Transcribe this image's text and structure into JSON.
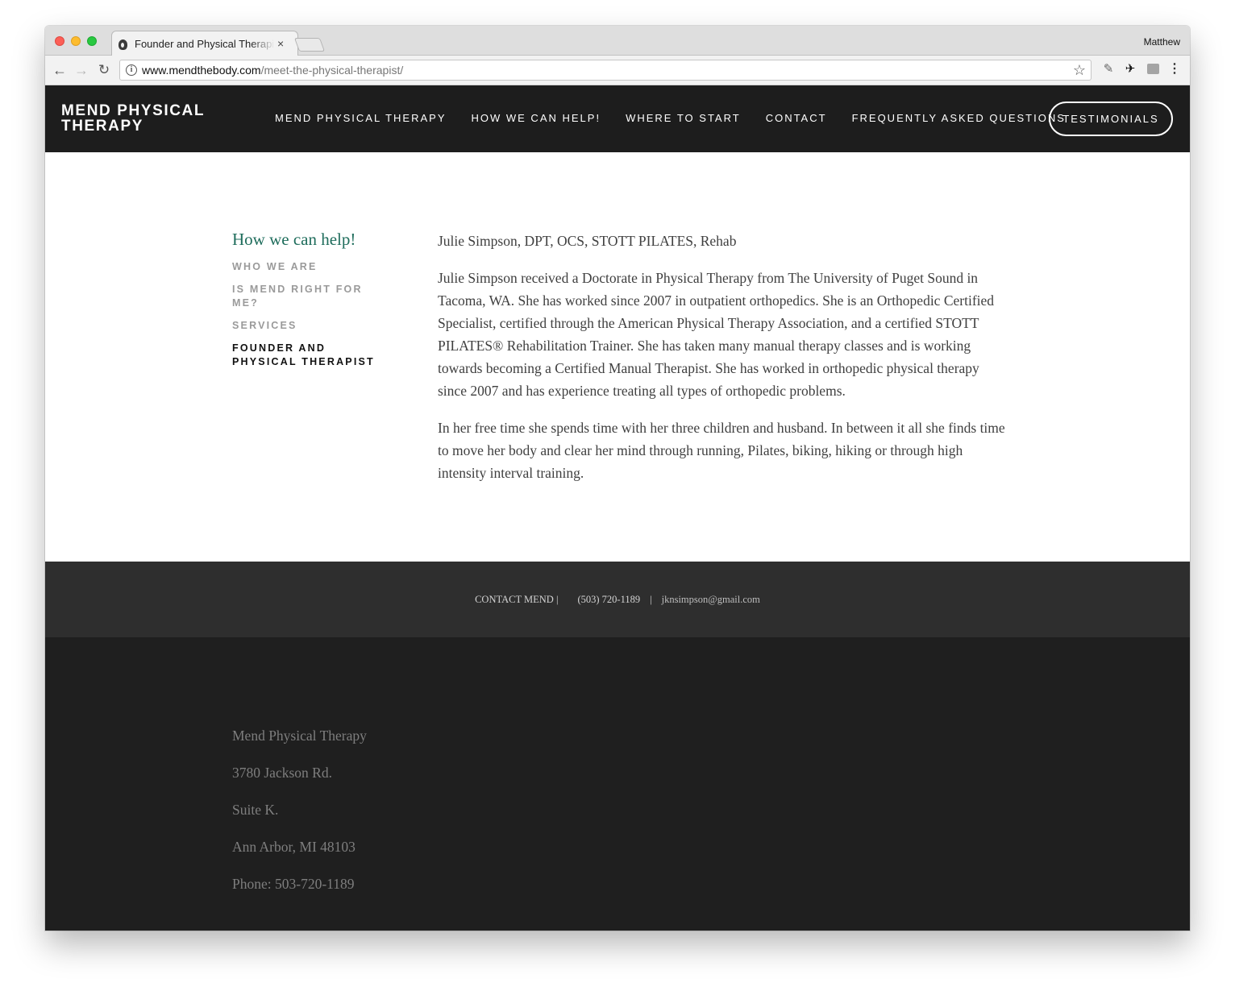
{
  "browser": {
    "tab_title": "Founder and Physical Therapist",
    "tab_close": "×",
    "profile_name": "Matthew",
    "url_host": "www.mendthebody.com",
    "url_path": "/meet-the-physical-therapist/",
    "icons": [
      "back-icon",
      "forward-icon",
      "reload-icon",
      "info-icon",
      "star-icon",
      "extension-icon",
      "menu-icon"
    ]
  },
  "header": {
    "logo": "MEND PHYSICAL THERAPY",
    "nav": [
      {
        "label": "MEND PHYSICAL THERAPY"
      },
      {
        "label": "HOW WE CAN HELP!"
      },
      {
        "label": "WHERE TO START"
      },
      {
        "label": "CONTACT"
      },
      {
        "label": "FREQUENTLY ASKED QUESTIONS"
      }
    ],
    "cta_label": "TESTIMONIALS"
  },
  "sidebar": {
    "heading": "How we can help!",
    "items": [
      {
        "label": "WHO WE ARE"
      },
      {
        "label": "IS MEND RIGHT FOR ME?"
      },
      {
        "label": "SERVICES"
      },
      {
        "label": "FOUNDER AND PHYSICAL THERAPIST"
      }
    ]
  },
  "article": {
    "credentials": "Julie Simpson, DPT, OCS, STOTT PILATES, Rehab",
    "bio": "Julie Simpson received a Doctorate in Physical Therapy from The University of Puget Sound in Tacoma, WA.  She has worked since 2007 in outpatient orthopedics.  She is an Orthopedic Certified Specialist, certified through the American Physical Therapy Association, and a certified STOTT PILATES® Rehabilitation Trainer.  She has taken many manual therapy classes and is working towards becoming a Certified Manual Therapist.  She has worked in orthopedic physical therapy since 2007 and has experience treating all types of orthopedic problems.",
    "personal": "In her free time she spends time with her three children and husband.  In between it all she finds time to move her body and clear her mind through running, Pilates, biking, hiking or through high intensity interval training."
  },
  "contact_bar": {
    "label": "CONTACT MEND |",
    "phone": "(503) 720-1189",
    "separator": "|",
    "email": "jknsimpson@gmail.com"
  },
  "footer": {
    "name": "Mend Physical Therapy",
    "street": "3780 Jackson Rd.",
    "suite": "Suite K.",
    "city": "Ann Arbor, MI 48103",
    "phone": "Phone: 503-720-1189"
  }
}
